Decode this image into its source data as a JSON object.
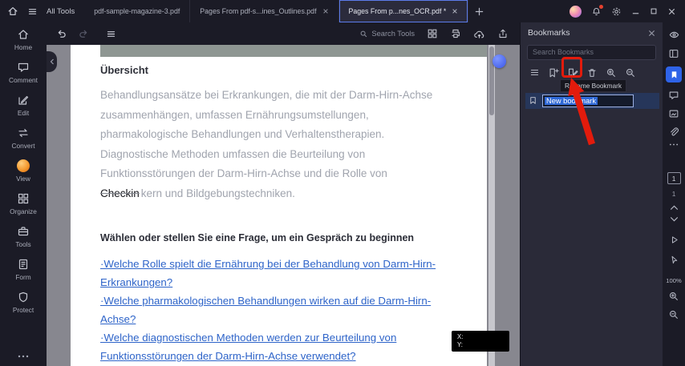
{
  "titlebar": {
    "all_tools_label": "All Tools",
    "tabs": [
      {
        "label": "pdf-sample-magazine-3.pdf"
      },
      {
        "label": "Pages From pdf-s...ines_Outlines.pdf"
      },
      {
        "label": "Pages From p...nes_OCR.pdf *"
      }
    ]
  },
  "toolbar": {
    "search_tools_label": "Search Tools"
  },
  "left_sidebar": {
    "items": [
      {
        "label": "Home"
      },
      {
        "label": "Comment"
      },
      {
        "label": "Edit"
      },
      {
        "label": "Convert"
      },
      {
        "label": "View"
      },
      {
        "label": "Organize"
      },
      {
        "label": "Tools"
      },
      {
        "label": "Form"
      },
      {
        "label": "Protect"
      }
    ]
  },
  "document": {
    "heading": "Übersicht",
    "paragraph_lines": [
      "Behandlungsansätze bei Erkrankungen, die mit der Darm-Hirn-Achse",
      "zusammenhängen, umfassen Ernährungsumstellungen,",
      "pharmakologische Behandlungen und Verhaltenstherapien.",
      "Diagnostische Methoden umfassen die Beurteilung von",
      "Funktionsstörungen der Darm-Hirn-Achse und die Rolle von"
    ],
    "edited_word": "Checkin",
    "last_line_rest": "kern und Bildgebungstechniken.",
    "question_heading": "Wählen oder stellen Sie eine Frage, um ein Gespräch zu beginnen",
    "link_lines": [
      "·Welche Rolle spielt die Ernährung bei der Behandlung von Darm-Hirn-",
      "Erkrankungen?",
      "·Welche pharmakologischen Behandlungen wirken auf die Darm-Hirn-",
      "Achse?",
      "·Welche diagnostischen Methoden werden zur Beurteilung von",
      "Funktionsstörungen der Darm-Hirn-Achse verwendet?"
    ]
  },
  "bookmarks_panel": {
    "title": "Bookmarks",
    "search_placeholder": "Search Bookmarks",
    "rename_tooltip": "Rename Bookmark",
    "bookmark_name": "New bookmark"
  },
  "right_rail": {
    "page_current": "1",
    "page_total": "1",
    "zoom_level": "100%"
  },
  "coordinate_tooltip": {
    "x_label": "X:",
    "y_label": "Y:"
  },
  "colors": {
    "accent_blue": "#2e63e8",
    "highlight_red": "#e21b0c",
    "link_blue": "#2e64c9",
    "selection_blue": "#2e68d6"
  }
}
